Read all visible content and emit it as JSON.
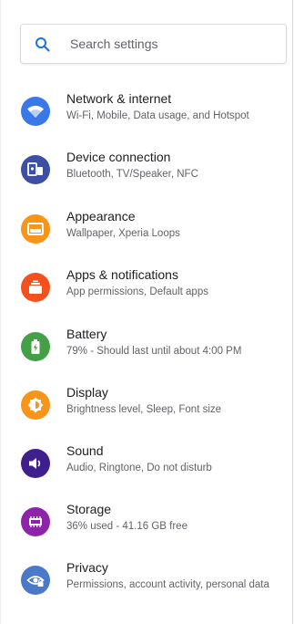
{
  "search": {
    "placeholder": "Search settings"
  },
  "colors": {
    "network": "#3b78e7",
    "device": "#3c4fa5",
    "appearance": "#f89418",
    "apps": "#f4511e",
    "battery": "#43a047",
    "display": "#f89418",
    "sound": "#3f1f8c",
    "storage": "#8e24aa",
    "privacy": "#4a79c9"
  },
  "items": [
    {
      "icon": "wifi-icon",
      "title": "Network & internet",
      "subtitle": "Wi-Fi, Mobile, Data usage, and Hotspot"
    },
    {
      "icon": "devices-icon",
      "title": "Device connection",
      "subtitle": "Bluetooth, TV/Speaker, NFC"
    },
    {
      "icon": "wallpaper-icon",
      "title": "Appearance",
      "subtitle": "Wallpaper, Xperia Loops"
    },
    {
      "icon": "apps-icon",
      "title": "Apps & notifications",
      "subtitle": "App permissions, Default apps"
    },
    {
      "icon": "battery-icon",
      "title": "Battery",
      "subtitle": "79% - Should last until about 4:00 PM"
    },
    {
      "icon": "brightness-icon",
      "title": "Display",
      "subtitle": "Brightness level, Sleep, Font size"
    },
    {
      "icon": "volume-icon",
      "title": "Sound",
      "subtitle": "Audio, Ringtone, Do not disturb"
    },
    {
      "icon": "storage-icon",
      "title": "Storage",
      "subtitle": "36% used - 41.16 GB free"
    },
    {
      "icon": "privacy-eye-icon",
      "title": "Privacy",
      "subtitle": "Permissions, account activity, personal data"
    }
  ]
}
